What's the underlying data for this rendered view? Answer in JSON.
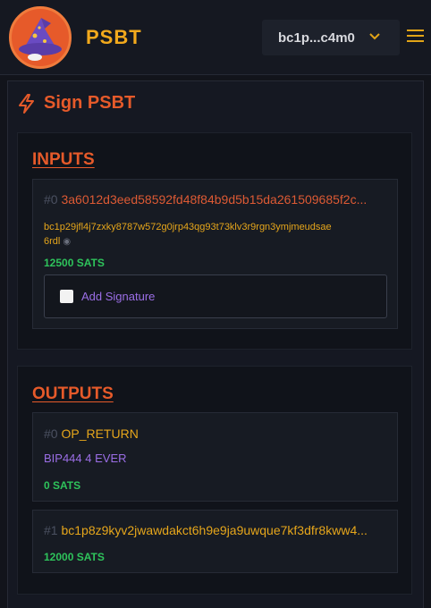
{
  "header": {
    "brand": "PSBT",
    "wallet_label": "bc1p...c4m0",
    "colors": {
      "accent": "#e2a417",
      "brand_orange": "#e65a2a"
    }
  },
  "page": {
    "title": "Sign PSBT"
  },
  "inputs": {
    "heading": "INPUTS",
    "items": [
      {
        "index": "#0",
        "txid": "3a6012d3eed58592fd48f84b9d5b15da261509685f2c...",
        "address_line1": "bc1p29jfl4j7zxky8787w572g0jrp43qg93t73klv3r9rgn3ymjmeudsae",
        "address_line2": "6rdl",
        "amount": "12500 SATS",
        "sign_label": "Add Signature"
      }
    ]
  },
  "outputs": {
    "heading": "OUTPUTS",
    "items": [
      {
        "index": "#0",
        "address": "OP_RETURN",
        "data": "BIP444 4 EVER",
        "amount": "0 SATS"
      },
      {
        "index": "#1",
        "address": "bc1p8z9kyv2jwawdakct6h9e9ja9uwque7kf3dfr8kww4...",
        "amount": "12000 SATS"
      }
    ]
  }
}
